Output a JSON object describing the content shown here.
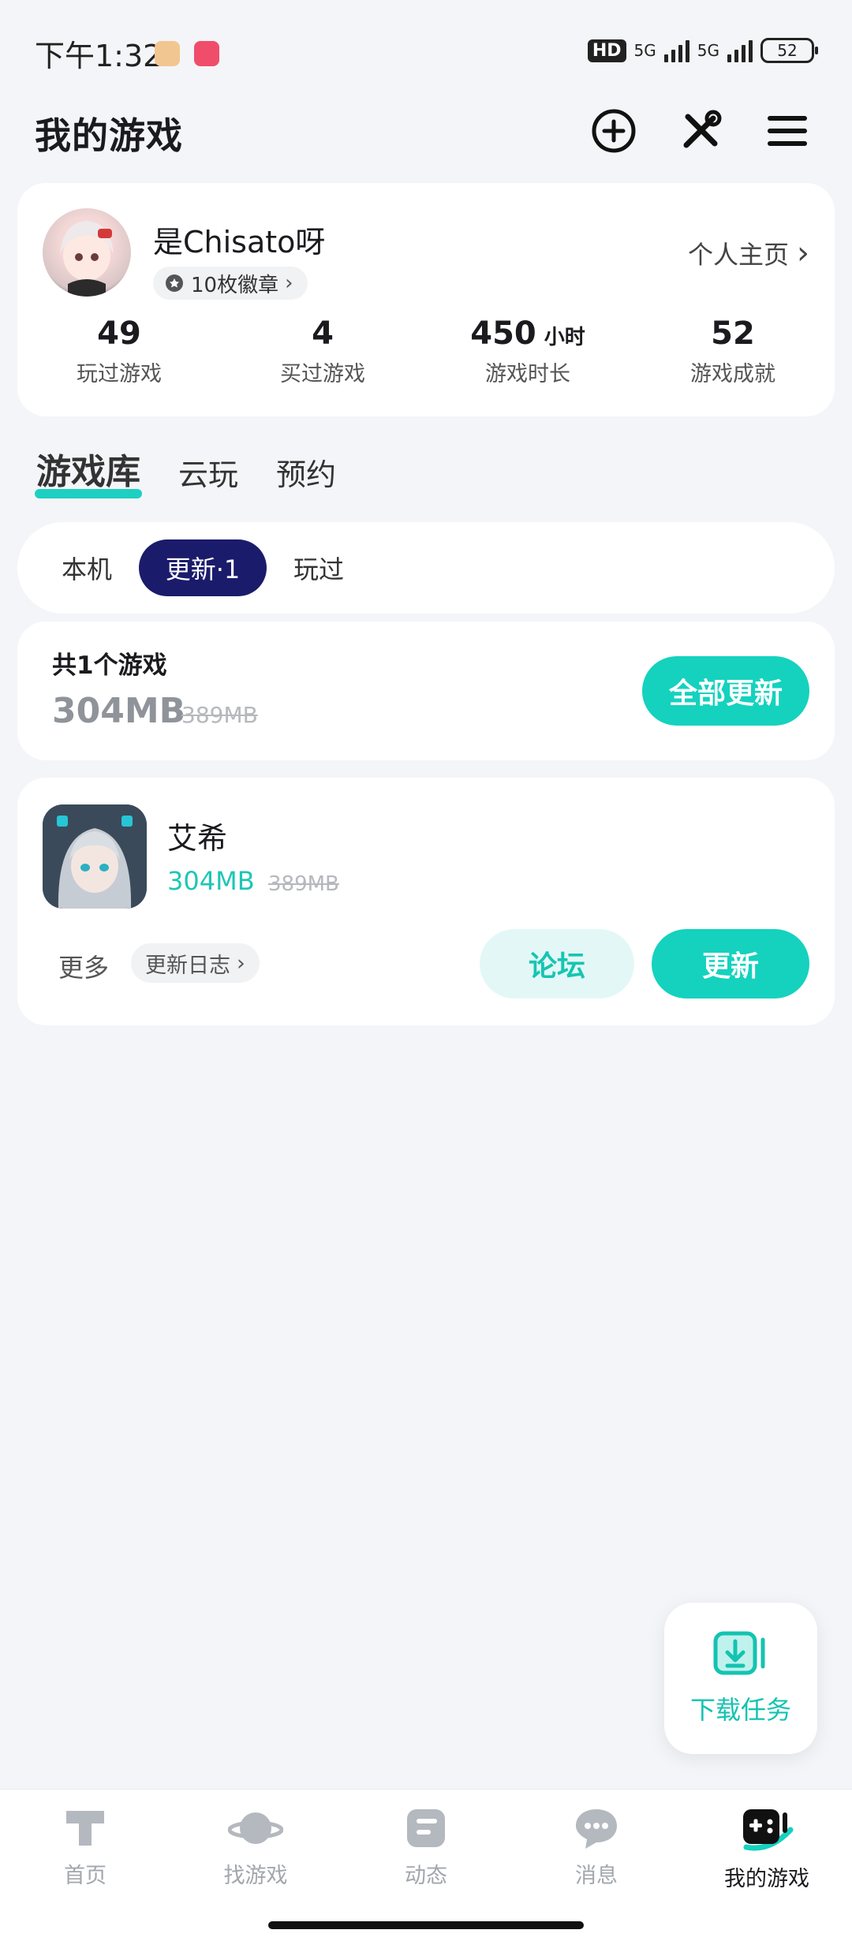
{
  "status_bar": {
    "time": "下午1:32",
    "hd_label": "HD",
    "network1": "5G",
    "network2": "5G",
    "battery": "52",
    "app_icon_colors": [
      "#f2c690",
      "#f04d6b"
    ]
  },
  "header": {
    "title": "我的游戏",
    "icons": [
      "add-circle-icon",
      "tools-icon",
      "menu-icon"
    ]
  },
  "profile": {
    "username": "是Chisato呀",
    "badges": "10枚徽章",
    "homepage_link": "个人主页",
    "stats": [
      {
        "value": "49",
        "unit": "",
        "label": "玩过游戏"
      },
      {
        "value": "4",
        "unit": "",
        "label": "买过游戏"
      },
      {
        "value": "450",
        "unit": "小时",
        "label": "游戏时长"
      },
      {
        "value": "52",
        "unit": "",
        "label": "游戏成就"
      }
    ]
  },
  "tabs": [
    {
      "label": "游戏库",
      "active": true
    },
    {
      "label": "云玩",
      "active": false
    },
    {
      "label": "预约",
      "active": false
    }
  ],
  "filter_chips": [
    {
      "label": "本机",
      "active": false
    },
    {
      "label": "更新·1",
      "active": true
    },
    {
      "label": "玩过",
      "active": false
    }
  ],
  "summary": {
    "count_text": "共1个游戏",
    "size": "304MB",
    "old_size": "389MB",
    "update_all_label": "全部更新"
  },
  "games": [
    {
      "name": "艾希",
      "size": "304MB",
      "old_size": "389MB",
      "more_label": "更多",
      "changelog_label": "更新日志",
      "forum_label": "论坛",
      "update_label": "更新"
    }
  ],
  "download_task": {
    "label": "下载任务"
  },
  "bottom_nav": [
    {
      "label": "首页",
      "icon": "home-t-icon",
      "active": false
    },
    {
      "label": "找游戏",
      "icon": "planet-icon",
      "active": false
    },
    {
      "label": "动态",
      "icon": "feed-icon",
      "active": false
    },
    {
      "label": "消息",
      "icon": "chat-bubble-icon",
      "active": false
    },
    {
      "label": "我的游戏",
      "icon": "gamepad-icon",
      "active": true
    }
  ],
  "colors": {
    "accent": "#14d2be",
    "chip_active": "#1b1b6b",
    "background": "#f4f5f8"
  }
}
